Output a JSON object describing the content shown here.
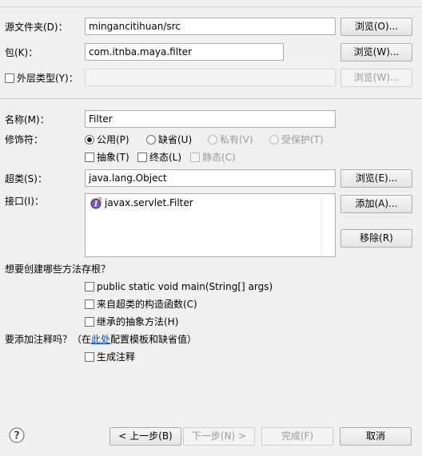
{
  "source_folder": {
    "label": "源文件夹(D)：",
    "value": "mingancitihuan/src",
    "browse": "浏览(O)..."
  },
  "package": {
    "label": "包(K)：",
    "value": "com.itnba.maya.filter",
    "browse": "浏览(W)..."
  },
  "enclosing_type": {
    "label": "外层类型(Y)：",
    "value": "",
    "browse": "浏览(W)..."
  },
  "name": {
    "label": "名称(M)：",
    "value": "Filter"
  },
  "modifiers": {
    "label": "修饰符：",
    "access": [
      {
        "label": "公用(P)",
        "checked": true,
        "disabled": false
      },
      {
        "label": "缺省(U)",
        "checked": false,
        "disabled": false
      },
      {
        "label": "私有(V)",
        "checked": false,
        "disabled": true
      },
      {
        "label": "受保护(T)",
        "checked": false,
        "disabled": true
      }
    ],
    "other": [
      {
        "label": "抽象(T)",
        "checked": false,
        "disabled": false
      },
      {
        "label": "终态(L)",
        "checked": false,
        "disabled": false
      },
      {
        "label": "静态(C)",
        "checked": false,
        "disabled": true
      }
    ]
  },
  "superclass": {
    "label": "超类(S)：",
    "value": "java.lang.Object",
    "browse": "浏览(E)..."
  },
  "interfaces": {
    "label": "接口(I)：",
    "items": [
      "javax.servlet.Filter"
    ],
    "icon": "interface-icon",
    "add": "添加(A)...",
    "remove": "移除(R)"
  },
  "stubs": {
    "question": "想要创建哪些方法存根？",
    "options": [
      {
        "label": "public static void main(String[] args)",
        "checked": false
      },
      {
        "label": "来自超类的构造函数(C)",
        "checked": false
      },
      {
        "label": "继承的抽象方法(H)",
        "checked": false
      }
    ]
  },
  "comments": {
    "question_prefix": "要添加注释吗？（在",
    "link": "此处",
    "question_suffix": "配置模板和缺省值）",
    "option": {
      "label": "生成注释",
      "checked": false
    }
  },
  "footer": {
    "help_icon": "help-icon",
    "back": "< 上一步(B)",
    "next": "下一步(N) >",
    "finish": "完成(F)",
    "cancel": "取消"
  },
  "colors": {
    "link": "#0645c8",
    "disabled_text": "#9a9a9a",
    "background": "#f0f0f0"
  }
}
